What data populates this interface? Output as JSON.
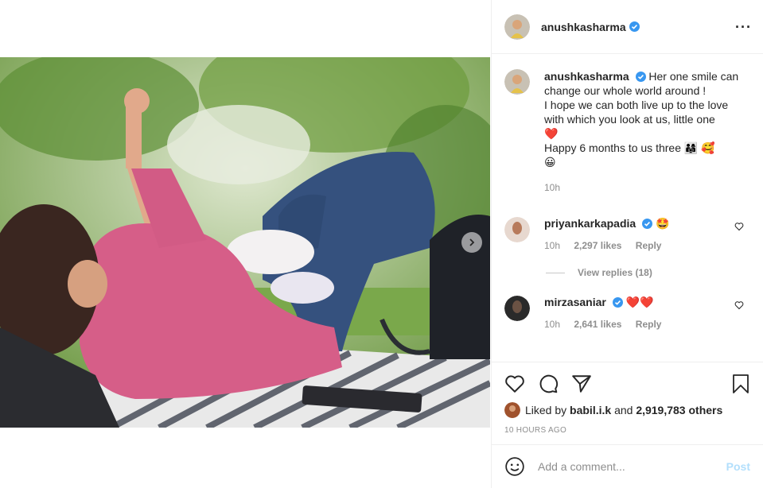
{
  "post": {
    "username": "anushkasharma",
    "more_icon": "more-horizontal-icon",
    "caption": {
      "line1": "Her one smile can",
      "line2": "change our whole world around !",
      "line3": "I hope we can both live up to the love",
      "line4": "with which you look at us, little one",
      "line5": "❤️",
      "line6": "Happy 6 months to us three 👨‍👩‍👧 🥰",
      "line7": "😀",
      "time": "10h"
    },
    "comments": [
      {
        "username": "priyankarkapadia",
        "text": "🤩",
        "time": "10h",
        "likes": "2,297 likes",
        "reply": "Reply",
        "view_replies": "View replies (18)"
      },
      {
        "username": "mirzasaniar",
        "text": "❤️❤️",
        "time": "10h",
        "likes": "2,641 likes",
        "reply": "Reply"
      }
    ],
    "liked_by": {
      "prefix": "Liked by",
      "user": "babil.i.k",
      "and": "and",
      "count": "2,919,783 others"
    },
    "timestamp": "10 HOURS AGO",
    "add_comment": {
      "placeholder": "Add a comment...",
      "post_label": "Post"
    }
  },
  "colors": {
    "verified": "#3897f0",
    "post_disabled": "#b2dffc",
    "muted": "#8e8e8e"
  }
}
